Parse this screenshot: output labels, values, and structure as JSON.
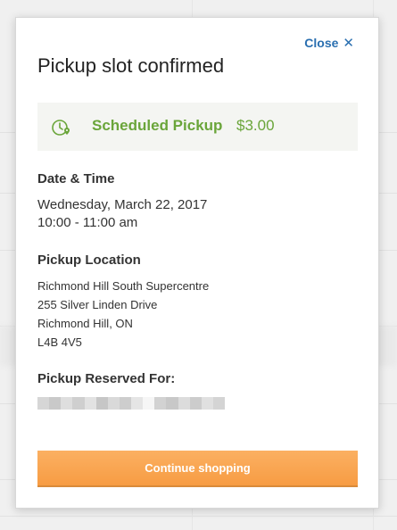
{
  "modal": {
    "close_label": "Close",
    "close_icon": "✕",
    "title": "Pickup slot confirmed"
  },
  "summary": {
    "label": "Scheduled Pickup",
    "price": "$3.00",
    "accent_color": "#6aa53a"
  },
  "datetime": {
    "heading": "Date & Time",
    "date": "Wednesday, March 22, 2017",
    "time": "10:00 - 11:00 am"
  },
  "location": {
    "heading": "Pickup Location",
    "lines": [
      "Richmond Hill South Supercentre",
      "255 Silver Linden Drive",
      "Richmond Hill, ON",
      "L4B 4V5"
    ]
  },
  "reserved": {
    "heading": "Pickup Reserved For:"
  },
  "actions": {
    "continue_label": "Continue shopping",
    "button_color": "#f8a24b"
  }
}
